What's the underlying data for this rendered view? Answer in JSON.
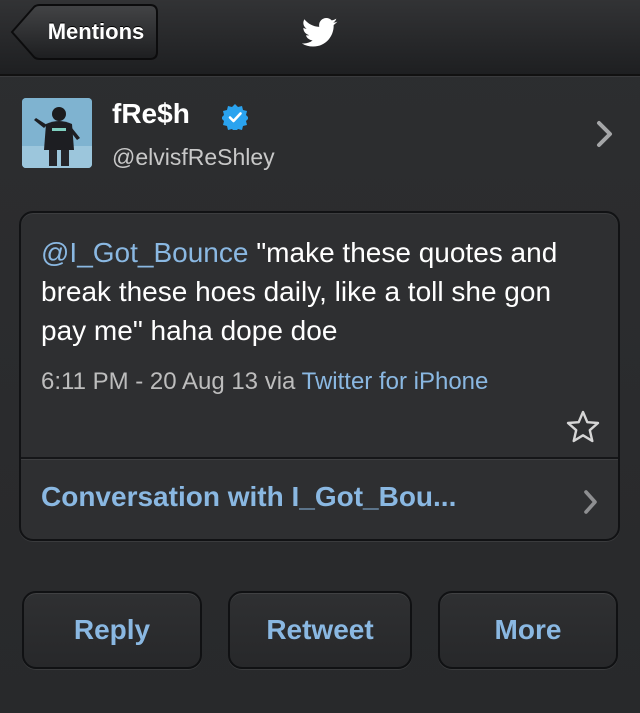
{
  "navbar": {
    "back_label": "Mentions"
  },
  "profile": {
    "name": "fRe$h",
    "handle": "@elvisfReShley",
    "verified": true
  },
  "tweet": {
    "mention": "@I_Got_Bounce",
    "text": " \"make these quotes and break these hoes daily, like a toll she gon pay me\" haha dope doe",
    "timestamp": "6:11 PM - 20 Aug 13 via ",
    "source": "Twitter for iPhone",
    "conversation_label": "Conversation with I_Got_Bou..."
  },
  "actions": {
    "reply": "Reply",
    "retweet": "Retweet",
    "more": "More"
  },
  "colors": {
    "accent": "#8ab8e2",
    "background": "#2b2c2e",
    "verified": "#2aa3ef"
  },
  "icons": {
    "twitter": "twitter-bird-icon",
    "verified": "verified-badge-icon",
    "favorite": "star-icon",
    "chevron": "chevron-right-icon"
  }
}
